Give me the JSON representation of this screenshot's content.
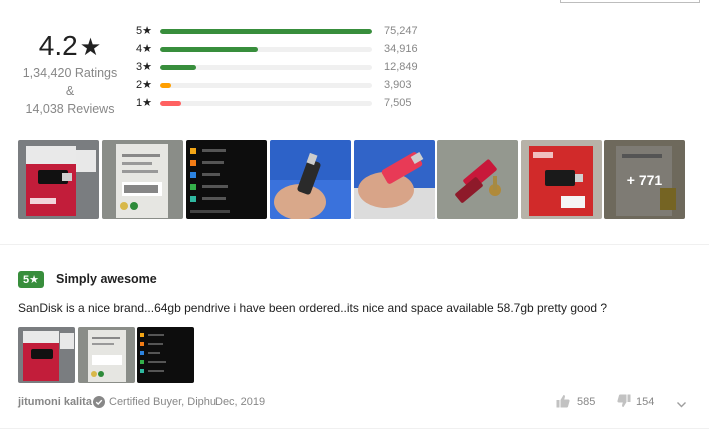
{
  "summary": {
    "average": "4.2",
    "star_glyph": "★",
    "ratings_text": "1,34,420 Ratings",
    "amp": "&",
    "reviews_text": "14,038 Reviews"
  },
  "histogram": [
    {
      "label": "5★",
      "count": "75,247",
      "fraction": 1.0,
      "color": "#388e3c"
    },
    {
      "label": "4★",
      "count": "34,916",
      "fraction": 0.464,
      "color": "#388e3c"
    },
    {
      "label": "3★",
      "count": "12,849",
      "fraction": 0.171,
      "color": "#388e3c"
    },
    {
      "label": "2★",
      "count": "3,903",
      "fraction": 0.052,
      "color": "#ff9f00"
    },
    {
      "label": "1★",
      "count": "7,505",
      "fraction": 0.1,
      "color": "#ff6161"
    }
  ],
  "gallery": {
    "more_label": "+ 771",
    "images": [
      "pendrive-package-photo",
      "pendrive-package-back-photo",
      "phone-storage-screenshot",
      "pendrive-blue-hand-photo",
      "pendrive-red-hand-photo",
      "pendrive-keys-photo",
      "pendrive-box-photo",
      "pendrive-package-photo-more"
    ]
  },
  "review": {
    "rating": "5",
    "star_glyph": "★",
    "title": "Simply awesome",
    "body": "SanDisk is a nice brand...64gb pendrive i have been ordered..its nice and space available 58.7gb pretty good ?",
    "images": [
      "pendrive-package-photo",
      "pendrive-package-back-photo",
      "phone-storage-screenshot"
    ],
    "reviewer": "jitumoni kalita",
    "certified": "Certified Buyer, Diphu",
    "date": "Dec, 2019",
    "likes": "585",
    "dislikes": "154"
  },
  "icons": {
    "verified": "check-circle-icon",
    "like": "thumbs-up-icon",
    "dislike": "thumbs-down-icon",
    "expand": "chevron-down-icon"
  },
  "colors": {
    "positive": "#388e3c",
    "neutral": "#ff9f00",
    "negative": "#ff6161",
    "muted_text": "#878787"
  }
}
